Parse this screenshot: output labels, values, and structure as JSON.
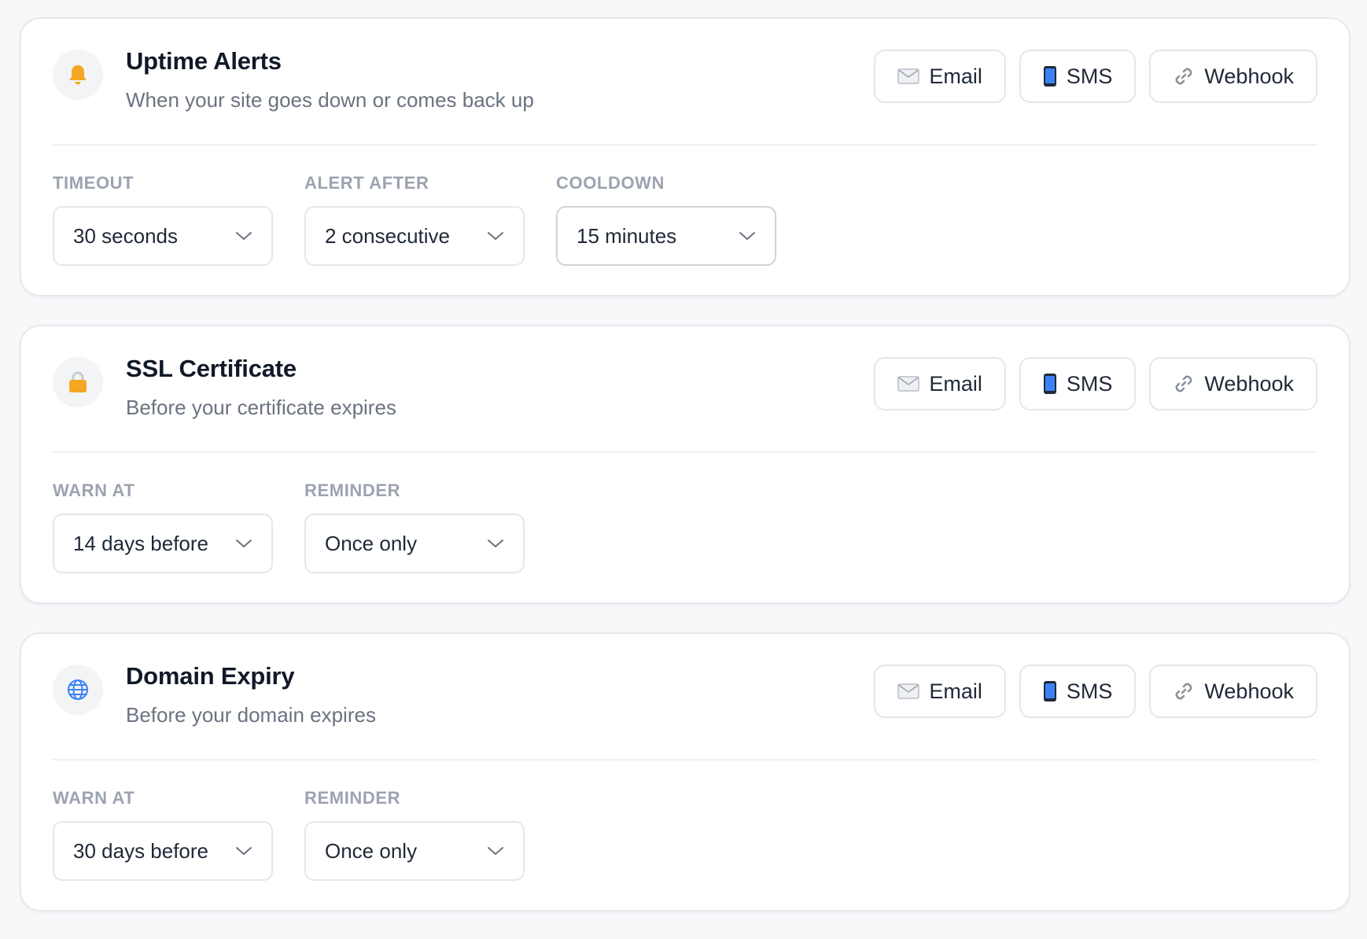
{
  "channels": {
    "email": "Email",
    "sms": "SMS",
    "webhook": "Webhook"
  },
  "colors": {
    "bell": "#f5a623",
    "lock": "#f5a623",
    "globe": "#3b82f6",
    "phone": "#2563eb"
  },
  "cards": [
    {
      "icon": "bell-icon",
      "title": "Uptime Alerts",
      "subtitle": "When your site goes down or comes back up",
      "fields": [
        {
          "label": "TIMEOUT",
          "value": "30 seconds"
        },
        {
          "label": "ALERT AFTER",
          "value": "2 consecutive"
        },
        {
          "label": "COOLDOWN",
          "value": "15 minutes"
        }
      ]
    },
    {
      "icon": "lock-icon",
      "title": "SSL Certificate",
      "subtitle": "Before your certificate expires",
      "fields": [
        {
          "label": "WARN AT",
          "value": "14 days before"
        },
        {
          "label": "REMINDER",
          "value": "Once only"
        }
      ]
    },
    {
      "icon": "globe-icon",
      "title": "Domain Expiry",
      "subtitle": "Before your domain expires",
      "fields": [
        {
          "label": "WARN AT",
          "value": "30 days before"
        },
        {
          "label": "REMINDER",
          "value": "Once only"
        }
      ]
    }
  ]
}
